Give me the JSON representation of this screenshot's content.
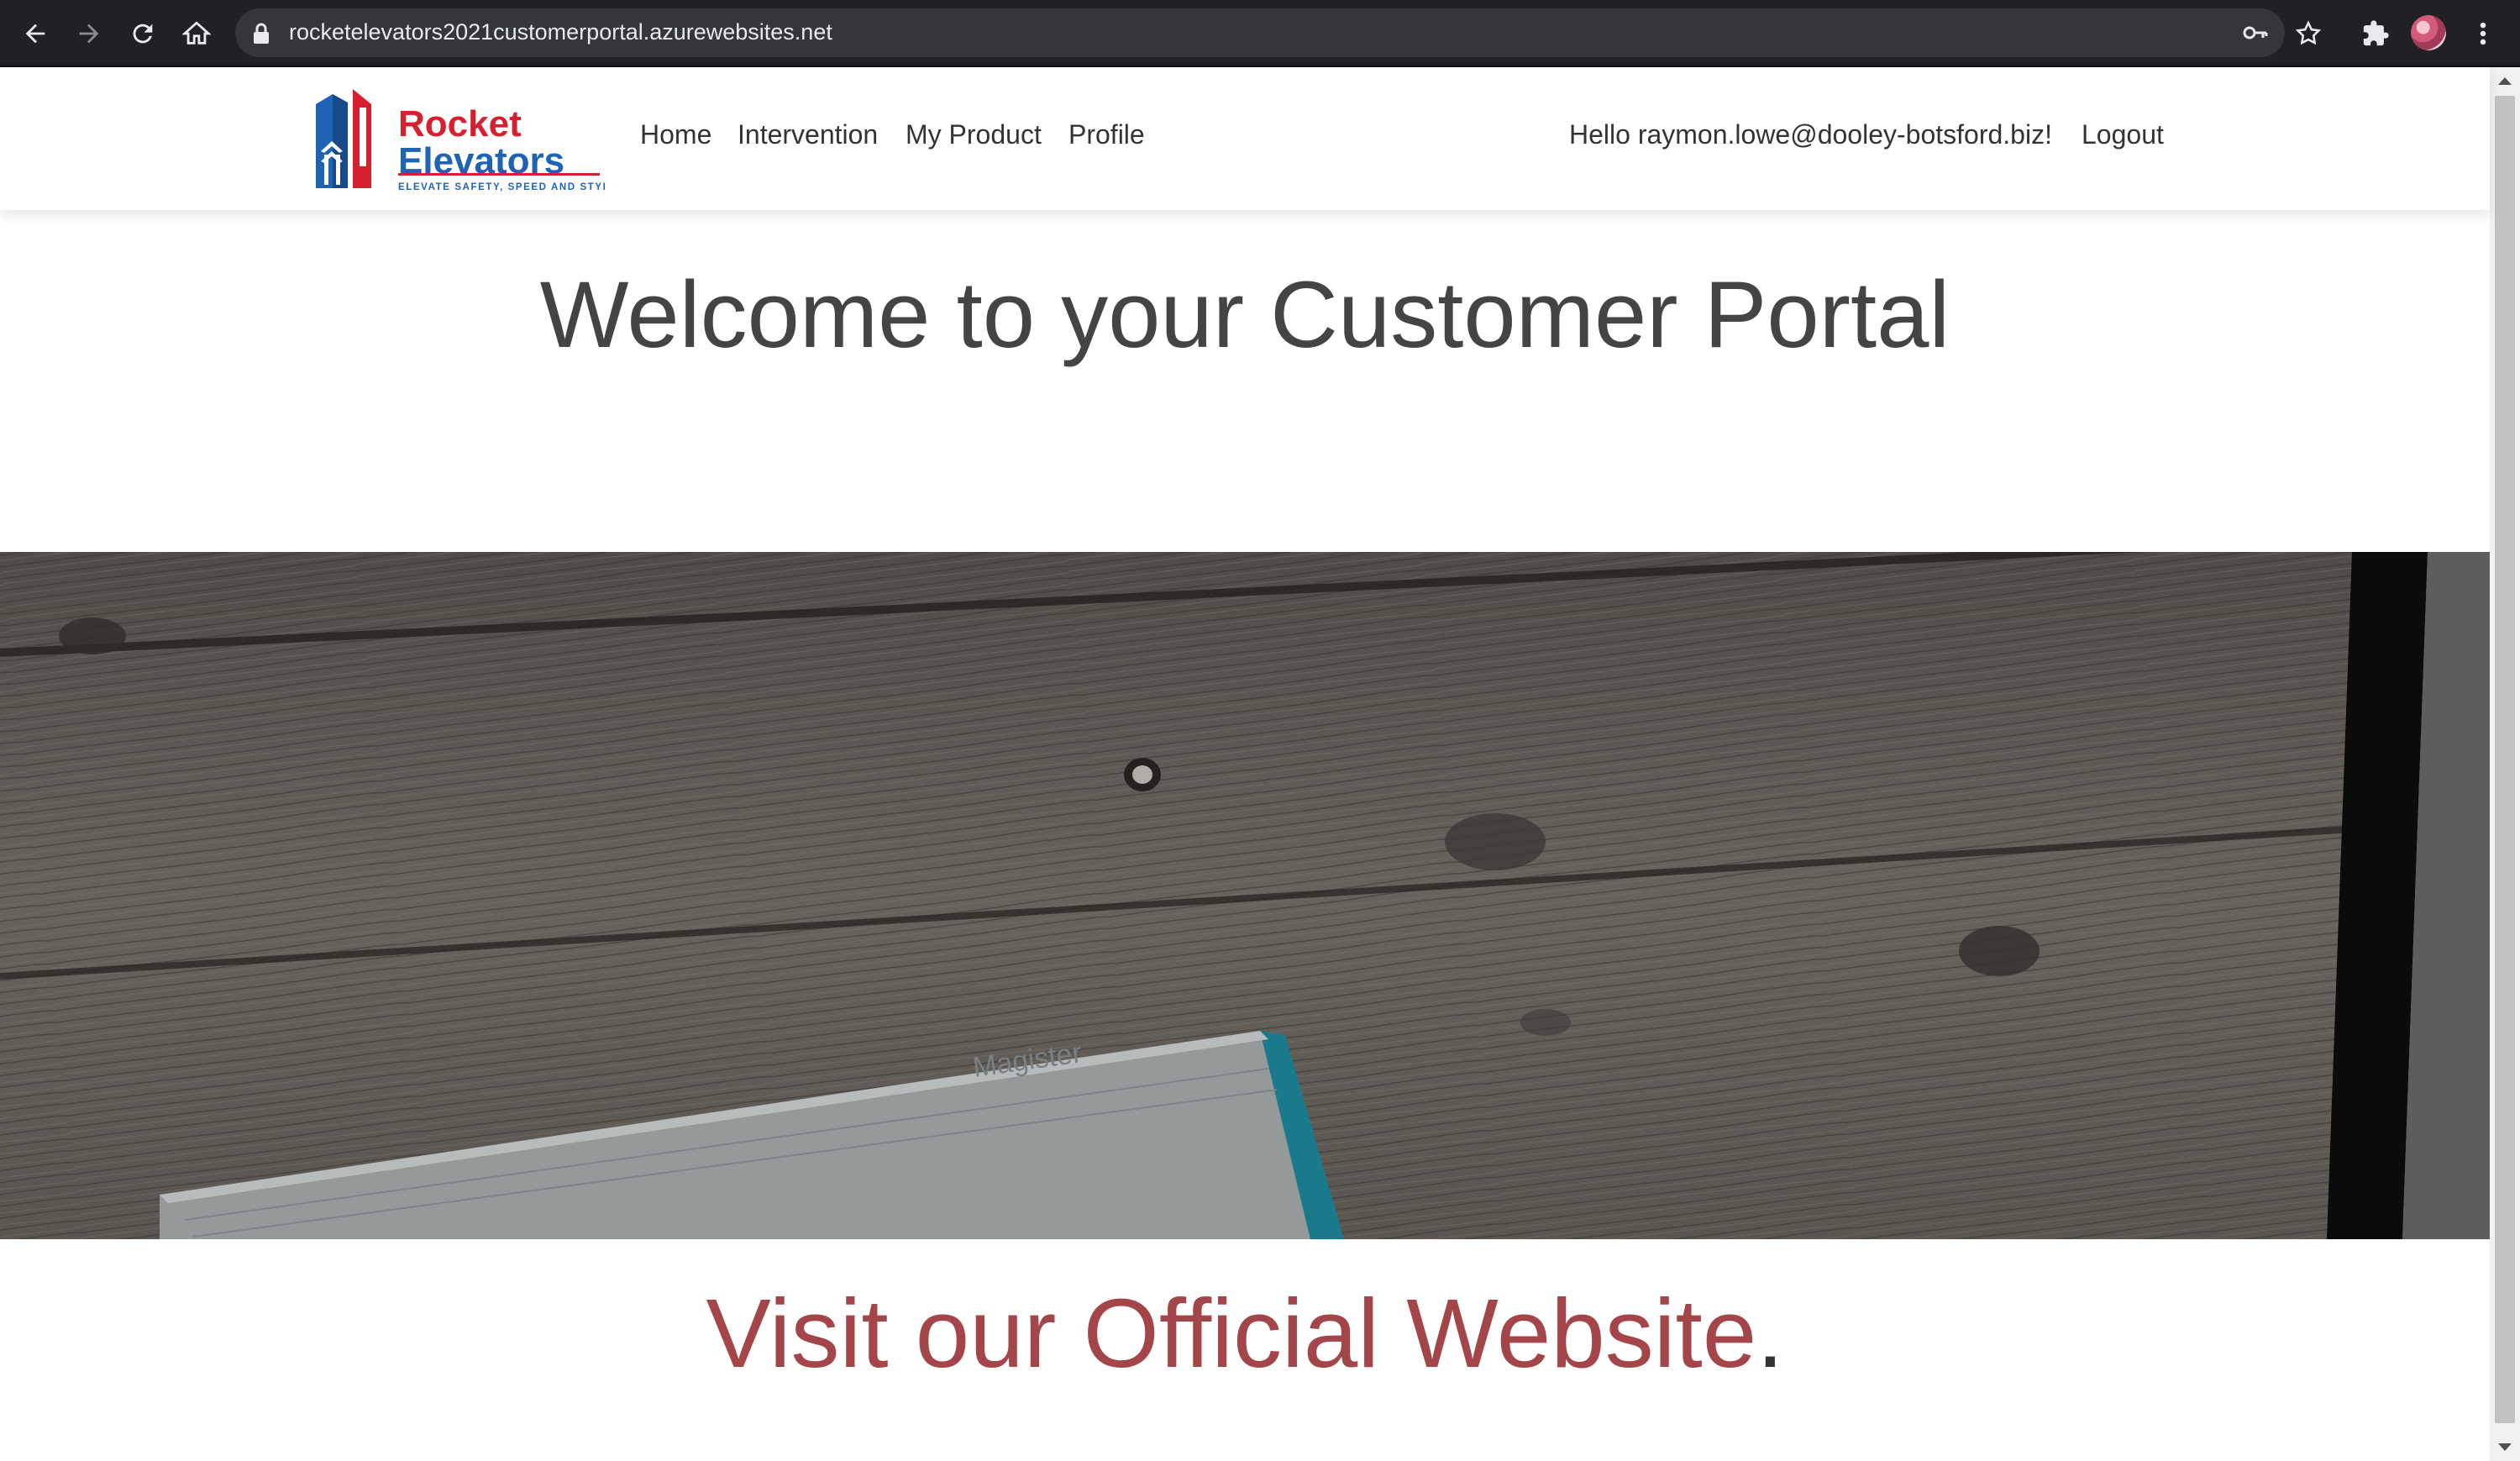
{
  "browser": {
    "url": "rocketelevators2021customerportal.azurewebsites.net"
  },
  "navbar": {
    "logo": {
      "name": "Rocket Elevators",
      "line1": "Rocket",
      "line2": "Elevators",
      "tagline": "ELEVATE SAFETY, SPEED AND STYLE"
    },
    "links": {
      "home": "Home",
      "intervention": "Intervention",
      "my_product": "My Product",
      "profile": "Profile"
    },
    "greeting": "Hello raymon.lowe@dooley-botsford.biz!",
    "logout": "Logout"
  },
  "main": {
    "title": "Welcome to your Customer Portal",
    "hero_book_text": "Magister",
    "visit_link": "Visit our Official Website",
    "visit_suffix": "."
  },
  "colors": {
    "link_red": "#a4454a",
    "text_dark": "#444444",
    "chrome_bg": "#202124"
  },
  "icons": {
    "back": "back-arrow-icon",
    "forward": "forward-arrow-icon",
    "reload": "reload-icon",
    "home": "home-icon",
    "lock": "lock-icon",
    "key": "key-icon",
    "star": "bookmark-star-icon",
    "extensions": "puzzle-icon",
    "menu": "kebab-menu-icon"
  }
}
